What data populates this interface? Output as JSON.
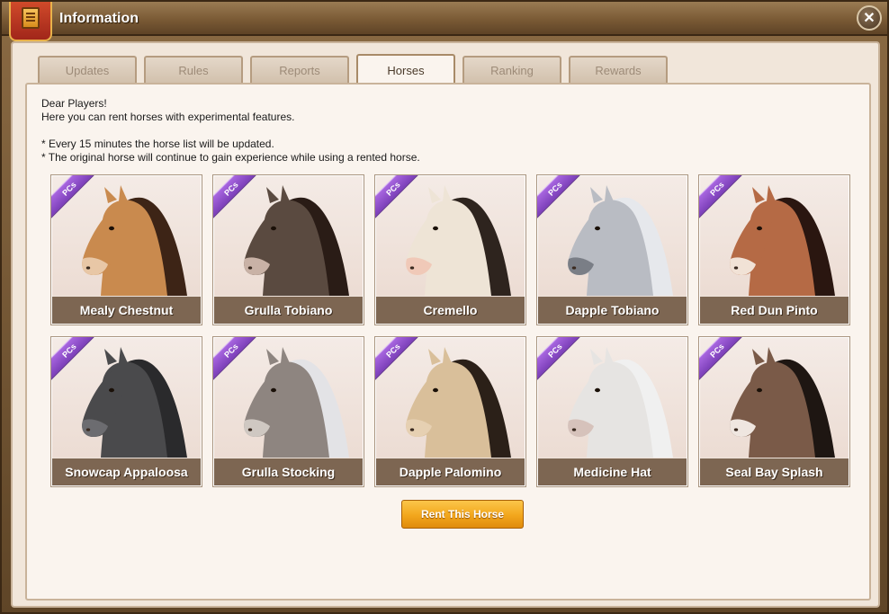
{
  "window": {
    "title": "Information"
  },
  "tabs": [
    {
      "label": "Updates"
    },
    {
      "label": "Rules"
    },
    {
      "label": "Reports"
    },
    {
      "label": "Horses"
    },
    {
      "label": "Ranking"
    },
    {
      "label": "Rewards"
    }
  ],
  "active_tab": "Horses",
  "intro": {
    "greeting": "Dear Players!",
    "line1": "Here you can rent horses with experimental features.",
    "note1": "* Every 15 minutes the horse list will be updated.",
    "note2": "* The original horse will continue to gain experience while using a rented horse."
  },
  "badge_text": "PCs",
  "horses": [
    {
      "name": "Mealy Chestnut",
      "coat": "#c98a4e",
      "mane": "#3d2416",
      "muzzle": "#e8c7a6"
    },
    {
      "name": "Grulla Tobiano",
      "coat": "#5a4a40",
      "mane": "#2a1c16",
      "muzzle": "#c9b2a6"
    },
    {
      "name": "Cremello",
      "coat": "#eee4d6",
      "mane": "#2e241e",
      "muzzle": "#f0c9b8"
    },
    {
      "name": "Dapple Tobiano",
      "coat": "#b9bcc3",
      "mane": "#e6e8ec",
      "muzzle": "#7a7e86"
    },
    {
      "name": "Red Dun Pinto",
      "coat": "#b56a45",
      "mane": "#2a1610",
      "muzzle": "#f1e2d6"
    },
    {
      "name": "Snowcap Appaloosa",
      "coat": "#4a4a4c",
      "mane": "#2a2a2c",
      "muzzle": "#6c6c70"
    },
    {
      "name": "Grulla Stocking",
      "coat": "#8e8580",
      "mane": "#e3e3e6",
      "muzzle": "#cfc8c2"
    },
    {
      "name": "Dapple Palomino",
      "coat": "#d9bf9a",
      "mane": "#2b2018",
      "muzzle": "#e6d0b2"
    },
    {
      "name": "Medicine Hat",
      "coat": "#e6e4e2",
      "mane": "#f0f0f0",
      "muzzle": "#d6c2bb"
    },
    {
      "name": "Seal Bay Splash",
      "coat": "#7a5a48",
      "mane": "#1e1612",
      "muzzle": "#efe6e0"
    }
  ],
  "rent_button": {
    "label": "Rent This Horse"
  }
}
